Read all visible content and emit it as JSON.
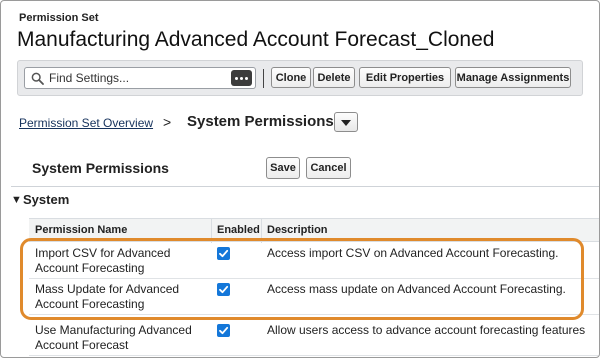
{
  "header": {
    "label": "Permission Set",
    "title": "Manufacturing Advanced Account Forecast_Cloned"
  },
  "toolbar": {
    "search_placeholder": "Find Settings...",
    "clone_label": "Clone",
    "delete_label": "Delete",
    "edit_properties_label": "Edit Properties",
    "manage_assignments_label": "Manage Assignments"
  },
  "breadcrumb": {
    "parent": "Permission Set Overview",
    "separator": ">",
    "current": "System Permissions"
  },
  "section": {
    "title": "System Permissions",
    "save_label": "Save",
    "cancel_label": "Cancel"
  },
  "group": {
    "toggle_icon": "▼",
    "title": "System"
  },
  "table": {
    "columns": [
      "Permission Name",
      "Enabled",
      "Description"
    ],
    "rows": [
      {
        "name_line1": "Import CSV for Advanced",
        "name_line2": "Account Forecasting",
        "enabled": true,
        "description": "Access import CSV on Advanced Account Forecasting."
      },
      {
        "name_line1": "Mass Update for Advanced",
        "name_line2": "Account Forecasting",
        "enabled": true,
        "description": "Access mass update on Advanced Account Forecasting."
      },
      {
        "name_line1": "Use Manufacturing Advanced",
        "name_line2": "Account Forecast",
        "enabled": true,
        "description": "Allow users access to advance account forecasting features"
      }
    ]
  },
  "colors": {
    "accent": "#1477d9",
    "highlight": "#e08a2c",
    "link": "#16325c"
  }
}
